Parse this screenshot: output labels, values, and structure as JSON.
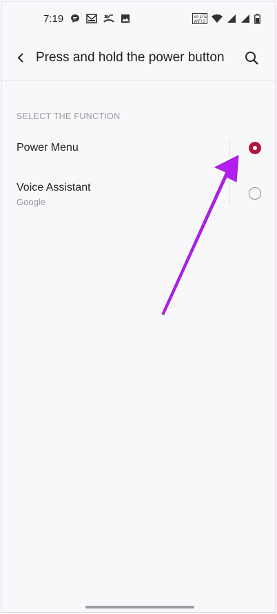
{
  "status_bar": {
    "time": "7:19",
    "left_icons": [
      "chat-bubble-icon",
      "gallery-icon",
      "missed-call-icon",
      "image-icon"
    ],
    "volte_label": "Vo LTE",
    "wifi_label": "WiFi 2",
    "right_icons": [
      "volte-icon",
      "wifi-icon",
      "signal-icon",
      "signal-icon-2",
      "battery-icon"
    ]
  },
  "header": {
    "title": "Press and hold the power button",
    "back_icon": "chevron-left-icon",
    "search_icon": "search-icon"
  },
  "section": {
    "header": "SELECT THE FUNCTION"
  },
  "options": [
    {
      "label": "Power Menu",
      "subtitle": "",
      "selected": true
    },
    {
      "label": "Voice Assistant",
      "subtitle": "Google",
      "selected": false
    }
  ],
  "colors": {
    "accent": "#b0193f",
    "annotation_arrow": "#b21ff0",
    "background": "#f8f8fa"
  }
}
